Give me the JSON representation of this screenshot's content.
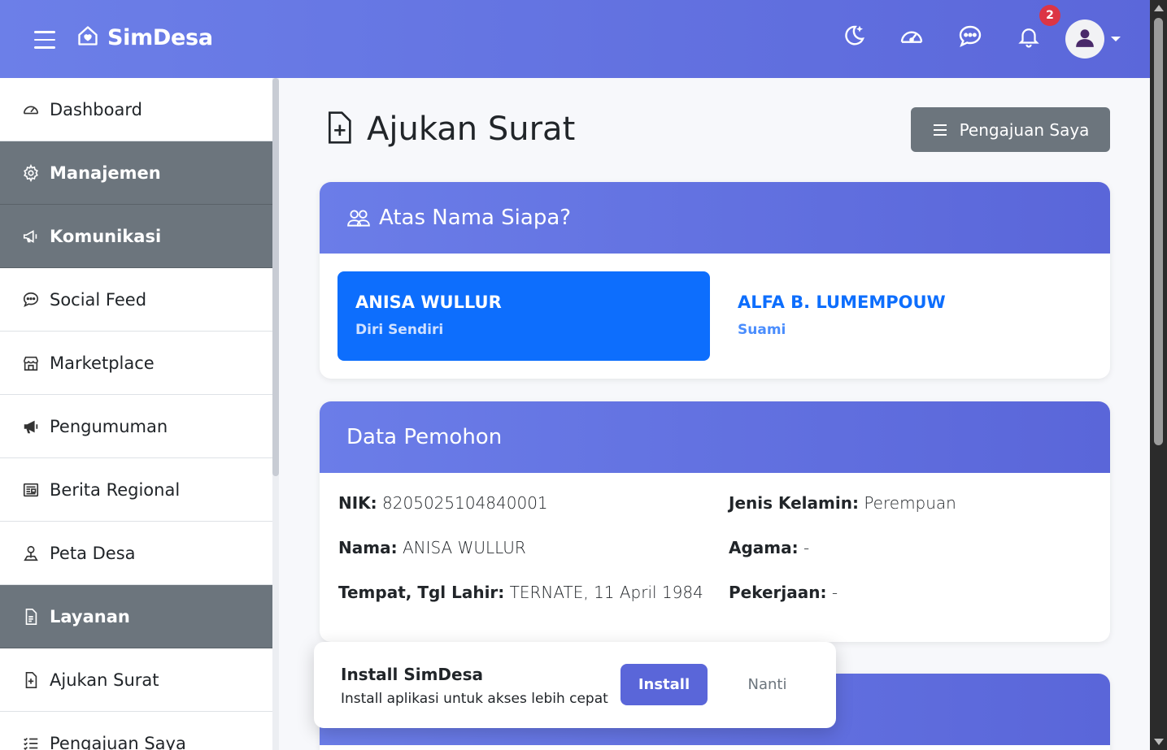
{
  "app": {
    "brand": "SimDesa",
    "notification_count": "2"
  },
  "icons": {
    "menu": "hamburger-icon",
    "brand": "house-heart-icon",
    "theme": "moon-stars-icon",
    "speed": "speedometer-icon",
    "chat": "chat-dots-icon",
    "bell": "bell-icon",
    "user": "person-icon"
  },
  "sidebar": {
    "items": [
      {
        "label": "Dashboard",
        "icon": "speedometer-icon",
        "section": false
      },
      {
        "label": "Manajemen",
        "icon": "gear-icon",
        "section": true
      },
      {
        "label": "Komunikasi",
        "icon": "megaphone-icon",
        "section": true
      },
      {
        "label": "Social Feed",
        "icon": "chat-dots-icon",
        "section": false
      },
      {
        "label": "Marketplace",
        "icon": "shop-icon",
        "section": false
      },
      {
        "label": "Pengumuman",
        "icon": "megaphone-fill-icon",
        "section": false
      },
      {
        "label": "Berita Regional",
        "icon": "newspaper-icon",
        "section": false
      },
      {
        "label": "Peta Desa",
        "icon": "person-pin-icon",
        "section": false
      },
      {
        "label": "Layanan",
        "icon": "file-text-icon",
        "section": true
      },
      {
        "label": "Ajukan Surat",
        "icon": "file-plus-icon",
        "section": false
      },
      {
        "label": "Pengajuan Saya",
        "icon": "list-check-icon",
        "section": false
      }
    ]
  },
  "page": {
    "title": "Ajukan Surat",
    "my_submissions_label": "Pengajuan Saya"
  },
  "on_behalf": {
    "header": "Atas Nama Siapa?",
    "options": [
      {
        "name": "ANISA WULLUR",
        "relation": "Diri Sendiri",
        "selected": true
      },
      {
        "name": "ALFA B. LUMEMPOUW",
        "relation": "Suami",
        "selected": false
      }
    ]
  },
  "applicant": {
    "header": "Data Pemohon",
    "fields": {
      "nik_label": "NIK:",
      "nik": "8205025104840001",
      "nama_label": "Nama:",
      "nama": "ANISA WULLUR",
      "ttl_label": "Tempat, Tgl Lahir:",
      "ttl": "TERNATE, 11 April 1984",
      "jk_label": "Jenis Kelamin:",
      "jk": "Perempuan",
      "agama_label": "Agama:",
      "agama": "-",
      "pekerjaan_label": "Pekerjaan:",
      "pekerjaan": "-"
    }
  },
  "install_prompt": {
    "title": "Install SimDesa",
    "subtitle": "Install aplikasi untuk akses lebih cepat",
    "install_label": "Install",
    "later_label": "Nanti"
  },
  "colors": {
    "brand_gradient_start": "#6c7fe8",
    "brand_gradient_end": "#5b67da",
    "primary": "#0d6efd",
    "secondary": "#6c757d",
    "badge": "#dc3545"
  }
}
